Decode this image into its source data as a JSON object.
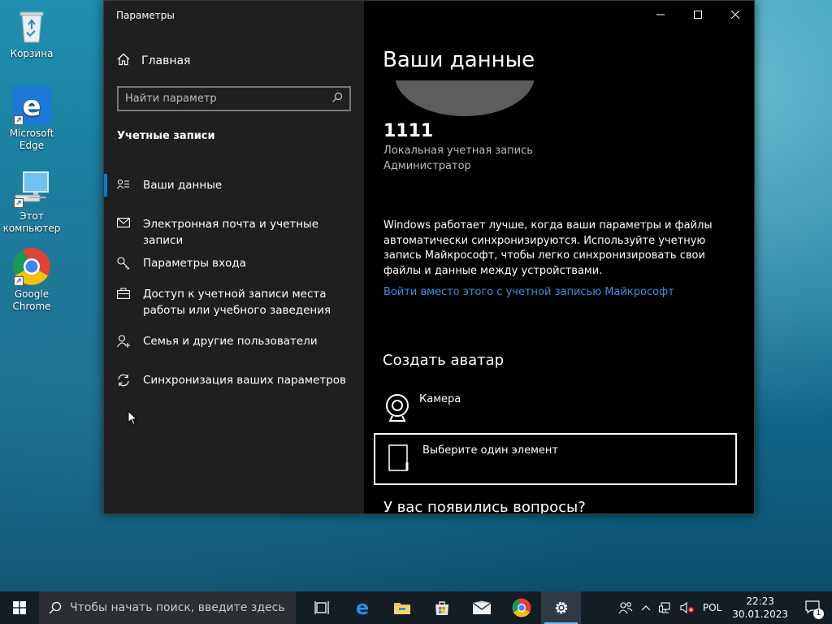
{
  "desktop": {
    "icons": [
      {
        "label": "Корзина"
      },
      {
        "label": "Microsoft Edge"
      },
      {
        "label": "Этот компьютер"
      },
      {
        "label": "Google Chrome"
      }
    ]
  },
  "window": {
    "title": "Параметры",
    "controls": {
      "minimize": "—",
      "maximize": "☐",
      "close": "✕"
    }
  },
  "sidebar": {
    "home_label": "Главная",
    "search_placeholder": "Найти параметр",
    "section_title": "Учетные записи",
    "items": [
      {
        "label": "Ваши данные",
        "icon": "person-list-icon",
        "active": true
      },
      {
        "label": "Электронная почта и учетные записи",
        "icon": "mail-icon"
      },
      {
        "label": "Параметры входа",
        "icon": "key-icon"
      },
      {
        "label": "Доступ к учетной записи места работы или учебного заведения",
        "icon": "briefcase-icon"
      },
      {
        "label": "Семья и другие пользователи",
        "icon": "add-person-icon"
      },
      {
        "label": "Синхронизация ваших параметров",
        "icon": "sync-icon"
      }
    ]
  },
  "main": {
    "title": "Ваши данные",
    "user_name": "1111",
    "account_type": "Локальная учетная запись",
    "account_role": "Администратор",
    "sync_text": "Windows работает лучше, когда ваши параметры и файлы автоматически синхронизируются. Используйте учетную запись Майкрософт, чтобы легко синхронизировать свои файлы и данные между устройствами.",
    "ms_link": "Войти вместо этого с учетной записью Майкрософт",
    "avatar_title": "Создать аватар",
    "camera_label": "Камера",
    "browse_label": "Выберите один элемент",
    "questions_title": "У вас появились вопросы?"
  },
  "taskbar": {
    "search_placeholder": "Чтобы начать поиск, введите здесь",
    "language": "POL",
    "time": "22:23",
    "date": "30.01.2023",
    "notification_count": "1"
  },
  "colors": {
    "accent": "#0078d7",
    "link": "#3a8fe0",
    "sidebar_bg": "#1f1f1f",
    "content_bg": "#000000"
  }
}
